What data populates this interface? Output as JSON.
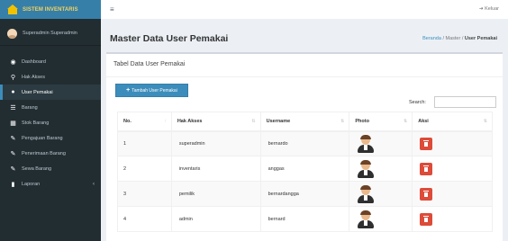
{
  "app": {
    "logo_text": "SISTEM INVENTARIS",
    "header_logout": "Keluar"
  },
  "sidebar": {
    "user_name": "Superadmin Superadmin",
    "items": [
      {
        "label": "Dashboard",
        "icon": "dashboard-icon"
      },
      {
        "label": "Hak Akses",
        "icon": "key-icon"
      },
      {
        "label": "User Pemakai",
        "icon": "user-icon",
        "active": true
      },
      {
        "label": "Barang",
        "icon": "list-icon"
      },
      {
        "label": "Stok Barang",
        "icon": "table-icon"
      },
      {
        "label": "Pengajuan Barang",
        "icon": "edit-icon"
      },
      {
        "label": "Penerimaan Barang",
        "icon": "edit-icon"
      },
      {
        "label": "Sewa Barang",
        "icon": "edit-icon"
      },
      {
        "label": "Laporan",
        "icon": "file-icon",
        "has_submenu": true
      }
    ]
  },
  "content": {
    "title": "Master Data User Pemakai",
    "breadcrumb": {
      "home": "Beranda",
      "sep1": "/",
      "mid": "Master",
      "sep2": "/",
      "active": "User Pemakai"
    },
    "box_title": "Tabel Data User Pemakai",
    "add_button_label": "Tambah User Pemakai",
    "search_label": "Search:",
    "search_value": ""
  },
  "table": {
    "headers": {
      "no": "No.",
      "akses": "Hak Akses",
      "username": "Username",
      "photo": "Photo",
      "aksi": "Aksi"
    },
    "rows": [
      {
        "no": "1",
        "akses": "superadmin",
        "username": "bernardo"
      },
      {
        "no": "2",
        "akses": "inventaris",
        "username": "anggas"
      },
      {
        "no": "3",
        "akses": "pemilik",
        "username": "bernardangga"
      },
      {
        "no": "4",
        "akses": "admin",
        "username": "bernard"
      }
    ]
  },
  "colors": {
    "sidebar_bg": "#222d32",
    "logo_bg": "#367fa9",
    "primary": "#3c8dbc",
    "danger": "#dd4b39"
  }
}
